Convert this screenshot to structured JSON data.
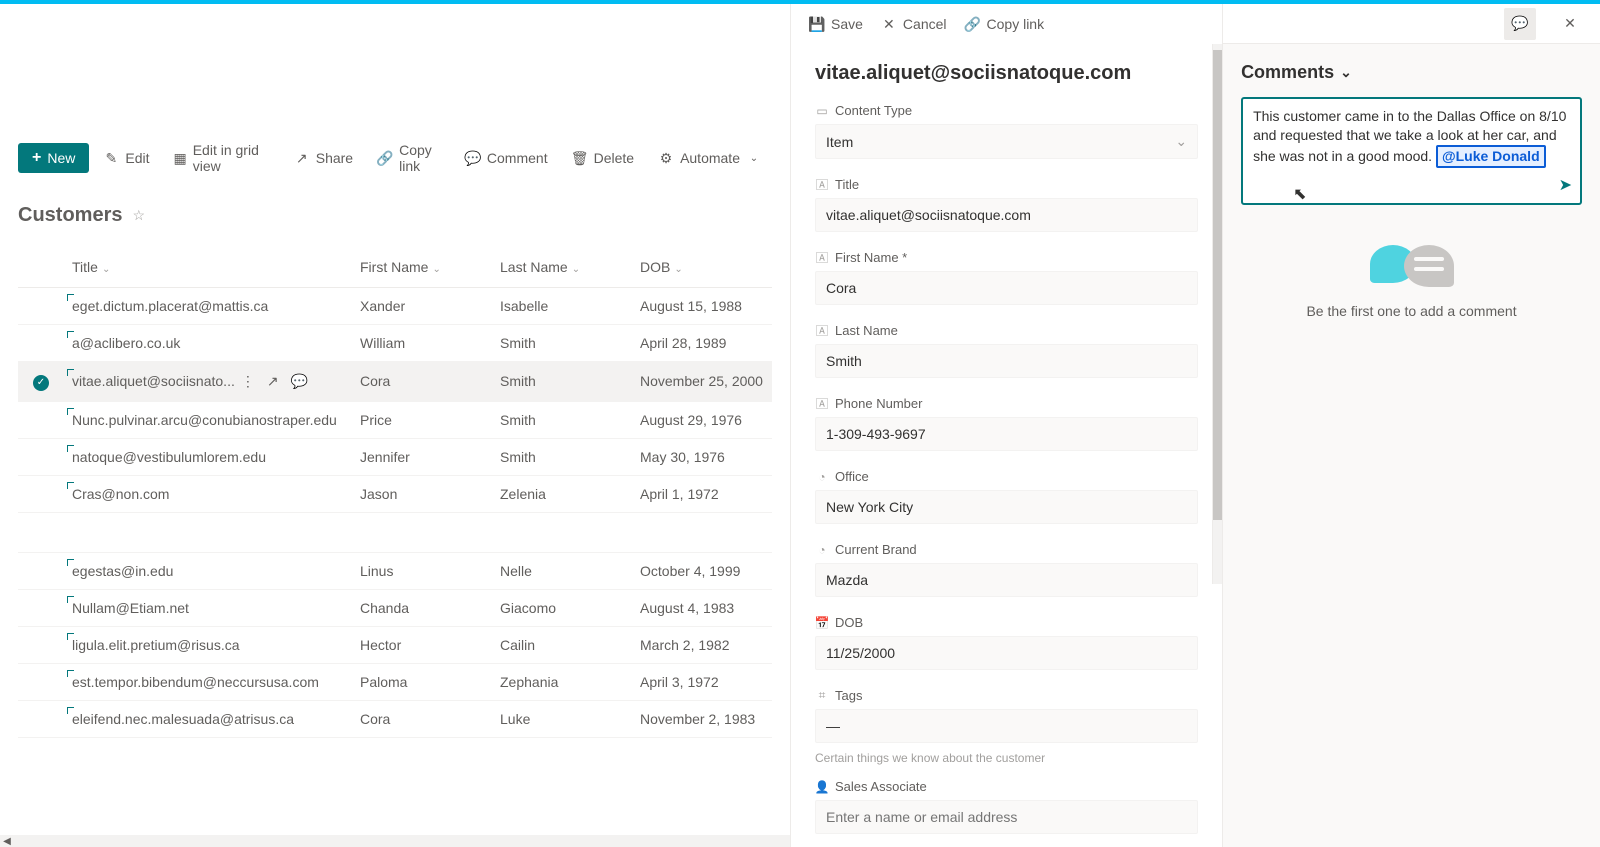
{
  "toolbar": {
    "new": "New",
    "edit": "Edit",
    "edit_grid": "Edit in grid view",
    "share": "Share",
    "copy_link": "Copy link",
    "comment": "Comment",
    "delete": "Delete",
    "automate": "Automate"
  },
  "list": {
    "title": "Customers",
    "columns": {
      "title": "Title",
      "first_name": "First Name",
      "last_name": "Last Name",
      "dob": "DOB"
    },
    "rows": [
      {
        "title": "eget.dictum.placerat@mattis.ca",
        "first": "Xander",
        "last": "Isabelle",
        "dob": "August 15, 1988"
      },
      {
        "title": "a@aclibero.co.uk",
        "first": "William",
        "last": "Smith",
        "dob": "April 28, 1989"
      },
      {
        "title": "vitae.aliquet@sociisnato...",
        "first": "Cora",
        "last": "Smith",
        "dob": "November 25, 2000",
        "selected": true
      },
      {
        "title": "Nunc.pulvinar.arcu@conubianostraper.edu",
        "first": "Price",
        "last": "Smith",
        "dob": "August 29, 1976"
      },
      {
        "title": "natoque@vestibulumlorem.edu",
        "first": "Jennifer",
        "last": "Smith",
        "dob": "May 30, 1976"
      },
      {
        "title": "Cras@non.com",
        "first": "Jason",
        "last": "Zelenia",
        "dob": "April 1, 1972"
      },
      {
        "title": "egestas@in.edu",
        "first": "Linus",
        "last": "Nelle",
        "dob": "October 4, 1999"
      },
      {
        "title": "Nullam@Etiam.net",
        "first": "Chanda",
        "last": "Giacomo",
        "dob": "August 4, 1983"
      },
      {
        "title": "ligula.elit.pretium@risus.ca",
        "first": "Hector",
        "last": "Cailin",
        "dob": "March 2, 1982"
      },
      {
        "title": "est.tempor.bibendum@neccursusa.com",
        "first": "Paloma",
        "last": "Zephania",
        "dob": "April 3, 1972"
      },
      {
        "title": "eleifend.nec.malesuada@atrisus.ca",
        "first": "Cora",
        "last": "Luke",
        "dob": "November 2, 1983"
      }
    ]
  },
  "detail": {
    "actions": {
      "save": "Save",
      "cancel": "Cancel",
      "copy_link": "Copy link"
    },
    "heading": "vitae.aliquet@sociisnatoque.com",
    "fields": {
      "content_type_label": "Content Type",
      "content_type_value": "Item",
      "title_label": "Title",
      "title_value": "vitae.aliquet@sociisnatoque.com",
      "first_name_label": "First Name *",
      "first_name_value": "Cora",
      "last_name_label": "Last Name",
      "last_name_value": "Smith",
      "phone_label": "Phone Number",
      "phone_value": "1-309-493-9697",
      "office_label": "Office",
      "office_value": "New York City",
      "brand_label": "Current Brand",
      "brand_value": "Mazda",
      "dob_label": "DOB",
      "dob_value": "11/25/2000",
      "tags_label": "Tags",
      "tags_value": "—",
      "note": "Certain things we know about the customer",
      "assoc_label": "Sales Associate",
      "assoc_placeholder": "Enter a name or email address"
    }
  },
  "comments": {
    "header": "Comments",
    "draft_text": "This customer came in to the Dallas Office on 8/10 and requested that we take a look at her car, and she was not in a good mood.",
    "mention": "@Luke Donald",
    "empty": "Be the first one to add a comment"
  }
}
